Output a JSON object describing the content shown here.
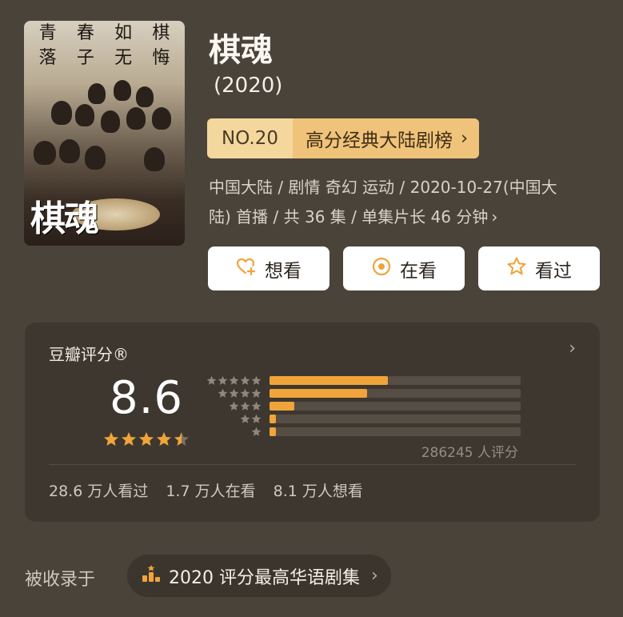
{
  "poster": {
    "tagline": [
      "青",
      "春",
      "如",
      "棋",
      "落",
      "子",
      "无",
      "悔"
    ],
    "title_text": "棋魂"
  },
  "show": {
    "title": "棋魂",
    "year": "(2020)"
  },
  "rank": {
    "number": "NO.20",
    "list_name": "高分经典大陆剧榜",
    "chevron": "›"
  },
  "meta": {
    "line1": "中国大陆 / 剧情 奇幻 运动 / 2020-10-27(中国大",
    "line2": "陆) 首播 / 共 36 集 / 单集片长 46 分钟",
    "chevron": "›"
  },
  "actions": {
    "want_label": "想看",
    "watching_label": "在看",
    "watched_label": "看过",
    "want_icon": "heart-plus-icon",
    "watching_icon": "radio-dot-icon",
    "watched_icon": "star-outline-icon"
  },
  "rating": {
    "heading": "豆瓣评分®",
    "chevron": "›",
    "score": "8.6",
    "stars_value": 4.5,
    "stars_max": 5,
    "distribution": [
      {
        "stars": 5,
        "fraction": 0.47
      },
      {
        "stars": 4,
        "fraction": 0.39
      },
      {
        "stars": 3,
        "fraction": 0.1
      },
      {
        "stars": 2,
        "fraction": 0.02
      },
      {
        "stars": 1,
        "fraction": 0.02
      }
    ],
    "votes": "286245 人评分",
    "watched": "28.6 万人看过",
    "watching": "1.7 万人在看",
    "want": "8.1 万人想看"
  },
  "collected": {
    "label": "被收录于",
    "item": "2020 评分最高华语剧集",
    "chevron": "›",
    "icon": "ranking-icon"
  },
  "colors": {
    "background": "#4a433a",
    "card": "#3d3730",
    "accent": "#f0a43a",
    "rank_light": "#f3d79d",
    "rank_dark": "#f0c37a"
  }
}
